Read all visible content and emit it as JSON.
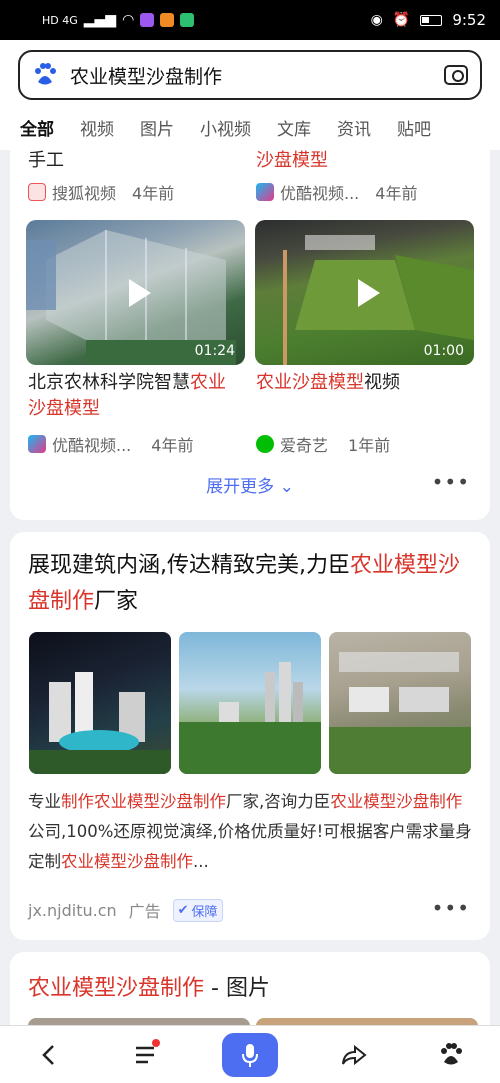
{
  "status": {
    "network": "HD 4G",
    "time": "9:52"
  },
  "search": {
    "query": "农业模型沙盘制作"
  },
  "tabs": [
    {
      "label": "全部"
    },
    {
      "label": "视频"
    },
    {
      "label": "图片"
    },
    {
      "label": "小视频"
    },
    {
      "label": "文库"
    },
    {
      "label": "资讯"
    },
    {
      "label": "贴吧"
    }
  ],
  "video_card": {
    "prev_left_title": "手工",
    "prev_right_title": "沙盘模型",
    "prev_left_source": "搜狐视频",
    "prev_left_age": "4年前",
    "prev_right_source": "优酷视频...",
    "prev_right_age": "4年前",
    "videos": [
      {
        "title_plain": "北京农林科学院智慧",
        "title_red": "农业沙盘模型",
        "duration": "01:24",
        "source": "优酷视频...",
        "age": "4年前"
      },
      {
        "title_red": "农业沙盘模型",
        "title_plain": "视频",
        "duration": "01:00",
        "source": "爱奇艺",
        "age": "1年前"
      }
    ],
    "expand": "展开更多",
    "more": "•••"
  },
  "ad_card": {
    "title_plain1": "展现建筑内涵,传达精致完美,力臣",
    "title_red1": "农业",
    "title_red2": "模型沙盘制作",
    "title_plain2": "厂家",
    "desc_1": "专业",
    "desc_2": "制作农业模型沙盘制作",
    "desc_3": "厂家,咨询力臣",
    "desc_4": "农业模型",
    "desc_5": "沙盘制作",
    "desc_6": "公司,100%还原视觉演绎,价格优质量好!可根据客户需求量身定制",
    "desc_7": "农业模型沙盘制作",
    "desc_8": "...",
    "domain": "jx.njditu.cn",
    "ad_label": "广告",
    "guarantee": "保障",
    "more": "•••"
  },
  "image_card": {
    "title_red": "农业模型沙盘制作",
    "title_plain": " - 图片"
  },
  "colors": {
    "accent": "#4e6ef2",
    "highlight": "#d9352b"
  }
}
